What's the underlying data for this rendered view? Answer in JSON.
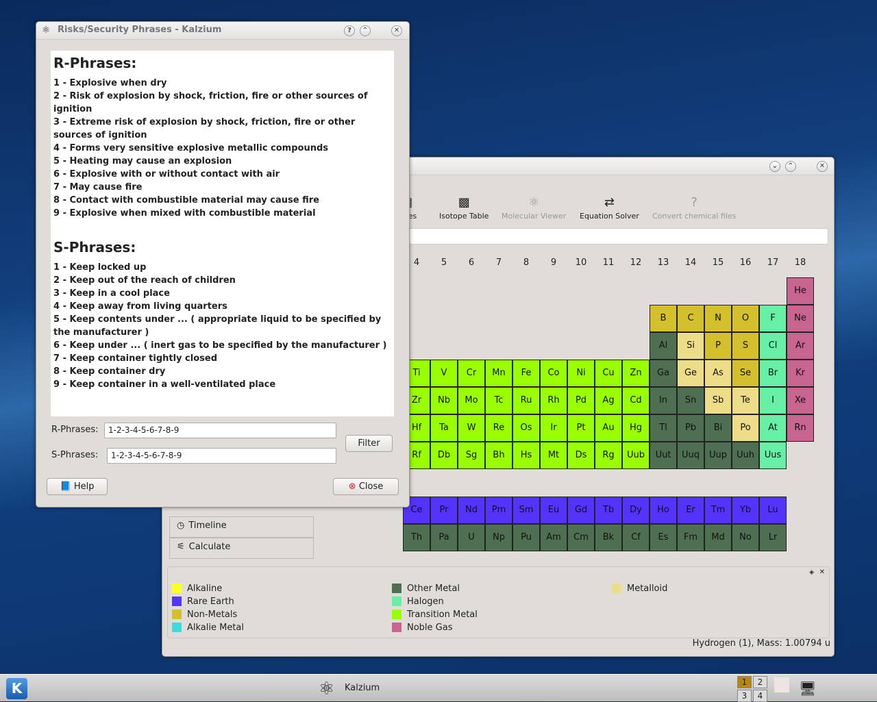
{
  "main_window": {
    "toolbar": [
      {
        "label": "ables",
        "icon": "tables-icon",
        "enabled": true
      },
      {
        "label": "Isotope Table",
        "icon": "isotope-table-icon",
        "enabled": true
      },
      {
        "label": "Molecular Viewer",
        "icon": "molecule-icon",
        "enabled": false
      },
      {
        "label": "Equation Solver",
        "icon": "equation-solver-icon",
        "enabled": true
      },
      {
        "label": "Convert chemical files",
        "icon": "unknown-file-icon",
        "enabled": false
      }
    ],
    "groups": [
      "4",
      "5",
      "6",
      "7",
      "8",
      "9",
      "10",
      "11",
      "12",
      "13",
      "14",
      "15",
      "16",
      "17",
      "18"
    ],
    "rows": [
      [
        null,
        null,
        null,
        null,
        null,
        null,
        null,
        null,
        null,
        null,
        null,
        null,
        null,
        null,
        [
          "He",
          "noble"
        ]
      ],
      [
        null,
        null,
        null,
        null,
        null,
        null,
        null,
        null,
        null,
        [
          "B",
          "nonmetal"
        ],
        [
          "C",
          "nonmetal"
        ],
        [
          "N",
          "nonmetal"
        ],
        [
          "O",
          "nonmetal"
        ],
        [
          "F",
          "halogen"
        ],
        [
          "Ne",
          "noble"
        ]
      ],
      [
        null,
        null,
        null,
        null,
        null,
        null,
        null,
        null,
        null,
        [
          "Al",
          "other"
        ],
        [
          "Si",
          "metalloid"
        ],
        [
          "P",
          "nonmetal"
        ],
        [
          "S",
          "nonmetal"
        ],
        [
          "Cl",
          "halogen"
        ],
        [
          "Ar",
          "noble"
        ]
      ],
      [
        [
          "Ti",
          "transition"
        ],
        [
          "V",
          "transition"
        ],
        [
          "Cr",
          "transition"
        ],
        [
          "Mn",
          "transition"
        ],
        [
          "Fe",
          "transition"
        ],
        [
          "Co",
          "transition"
        ],
        [
          "Ni",
          "transition"
        ],
        [
          "Cu",
          "transition"
        ],
        [
          "Zn",
          "transition"
        ],
        [
          "Ga",
          "other"
        ],
        [
          "Ge",
          "metalloid"
        ],
        [
          "As",
          "metalloid"
        ],
        [
          "Se",
          "nonmetal"
        ],
        [
          "Br",
          "halogen"
        ],
        [
          "Kr",
          "noble"
        ]
      ],
      [
        [
          "Zr",
          "transition"
        ],
        [
          "Nb",
          "transition"
        ],
        [
          "Mo",
          "transition"
        ],
        [
          "Tc",
          "transition"
        ],
        [
          "Ru",
          "transition"
        ],
        [
          "Rh",
          "transition"
        ],
        [
          "Pd",
          "transition"
        ],
        [
          "Ag",
          "transition"
        ],
        [
          "Cd",
          "transition"
        ],
        [
          "In",
          "other"
        ],
        [
          "Sn",
          "other"
        ],
        [
          "Sb",
          "metalloid"
        ],
        [
          "Te",
          "metalloid"
        ],
        [
          "I",
          "halogen"
        ],
        [
          "Xe",
          "noble"
        ]
      ],
      [
        [
          "Hf",
          "transition"
        ],
        [
          "Ta",
          "transition"
        ],
        [
          "W",
          "transition"
        ],
        [
          "Re",
          "transition"
        ],
        [
          "Os",
          "transition"
        ],
        [
          "Ir",
          "transition"
        ],
        [
          "Pt",
          "transition"
        ],
        [
          "Au",
          "transition"
        ],
        [
          "Hg",
          "transition"
        ],
        [
          "Tl",
          "other"
        ],
        [
          "Pb",
          "other"
        ],
        [
          "Bi",
          "other"
        ],
        [
          "Po",
          "metalloid"
        ],
        [
          "At",
          "halogen"
        ],
        [
          "Rn",
          "noble"
        ]
      ],
      [
        [
          "Rf",
          "transition"
        ],
        [
          "Db",
          "transition"
        ],
        [
          "Sg",
          "transition"
        ],
        [
          "Bh",
          "transition"
        ],
        [
          "Hs",
          "transition"
        ],
        [
          "Mt",
          "transition"
        ],
        [
          "Ds",
          "transition"
        ],
        [
          "Rg",
          "transition"
        ],
        [
          "Uub",
          "transition"
        ],
        [
          "Uut",
          "other"
        ],
        [
          "Uuq",
          "other"
        ],
        [
          "Uup",
          "other"
        ],
        [
          "Uuh",
          "other"
        ],
        [
          "Uus",
          "halogen"
        ],
        null
      ]
    ],
    "lanthanides": [
      "Ce",
      "Pr",
      "Nd",
      "Pm",
      "Sm",
      "Eu",
      "Gd",
      "Tb",
      "Dy",
      "Ho",
      "Er",
      "Tm",
      "Yb",
      "Lu"
    ],
    "actinides": [
      "Th",
      "Pa",
      "U",
      "Np",
      "Pu",
      "Am",
      "Cm",
      "Bk",
      "Cf",
      "Es",
      "Fm",
      "Md",
      "No",
      "Lr"
    ],
    "sidebar": [
      {
        "label": "Timeline",
        "icon": "clock-icon"
      },
      {
        "label": "Calculate",
        "icon": "calculate-icon"
      }
    ],
    "colors": {
      "alkaline": "#ffff22",
      "rare": "#5533ff",
      "nonmetal": "#d4c02a",
      "alkali": "#3edcdc",
      "other": "#4f6f52",
      "halogen": "#66f0a6",
      "transition": "#99ff00",
      "noble": "#c86490",
      "metalloid": "#eedd88"
    },
    "legend": [
      {
        "label": "Alkaline",
        "key": "alkaline"
      },
      {
        "label": "Rare Earth",
        "key": "rare"
      },
      {
        "label": "Non-Metals",
        "key": "nonmetal"
      },
      {
        "label": "Alkalie Metal",
        "key": "alkali"
      },
      {
        "label": "Other Metal",
        "key": "other"
      },
      {
        "label": "Halogen",
        "key": "halogen"
      },
      {
        "label": "Transition Metal",
        "key": "transition"
      },
      {
        "label": "Noble Gas",
        "key": "noble"
      },
      {
        "label": "Metalloid",
        "key": "metalloid"
      }
    ],
    "status": "Hydrogen (1), Mass: 1.00794 u"
  },
  "dialog": {
    "title": "Risks/Security Phrases - Kalzium",
    "r_heading": "R-Phrases:",
    "r_phrases": [
      "1 - Explosive when dry",
      "2 - Risk of explosion by shock, friction, fire or other sources of ignition",
      "3 - Extreme risk of explosion by shock, friction, fire or other sources of ignition",
      "4 - Forms very sensitive explosive metallic compounds",
      "5 - Heating may cause an explosion",
      "6 - Explosive with or without contact with air",
      "7 - May cause fire",
      "8 - Contact with combustible material may cause fire",
      "9 - Explosive when mixed with combustible material"
    ],
    "s_heading": "S-Phrases:",
    "s_phrases": [
      "1 - Keep locked up",
      "2 - Keep out of the reach of children",
      "3 - Keep in a cool place",
      "4 - Keep away from living quarters",
      "5 - Keep contents under ... ( appropriate liquid to be specified by the manufacturer )",
      "6 - Keep under ... ( inert gas to be specified by the manufacturer )",
      "7 - Keep container tightly closed",
      "8 - Keep container dry",
      "9 - Keep container in a well-ventilated place"
    ],
    "r_label": "R-Phrases:",
    "r_value": "1-2-3-4-5-6-7-8-9",
    "s_label": "S-Phrases:",
    "s_value": "1-2-3-4-5-6-7-8-9",
    "filter": "Filter",
    "help": "Help",
    "close": "Close"
  },
  "taskbar": {
    "app": "Kalzium",
    "desktops": [
      "1",
      "2",
      "3",
      "4"
    ]
  }
}
